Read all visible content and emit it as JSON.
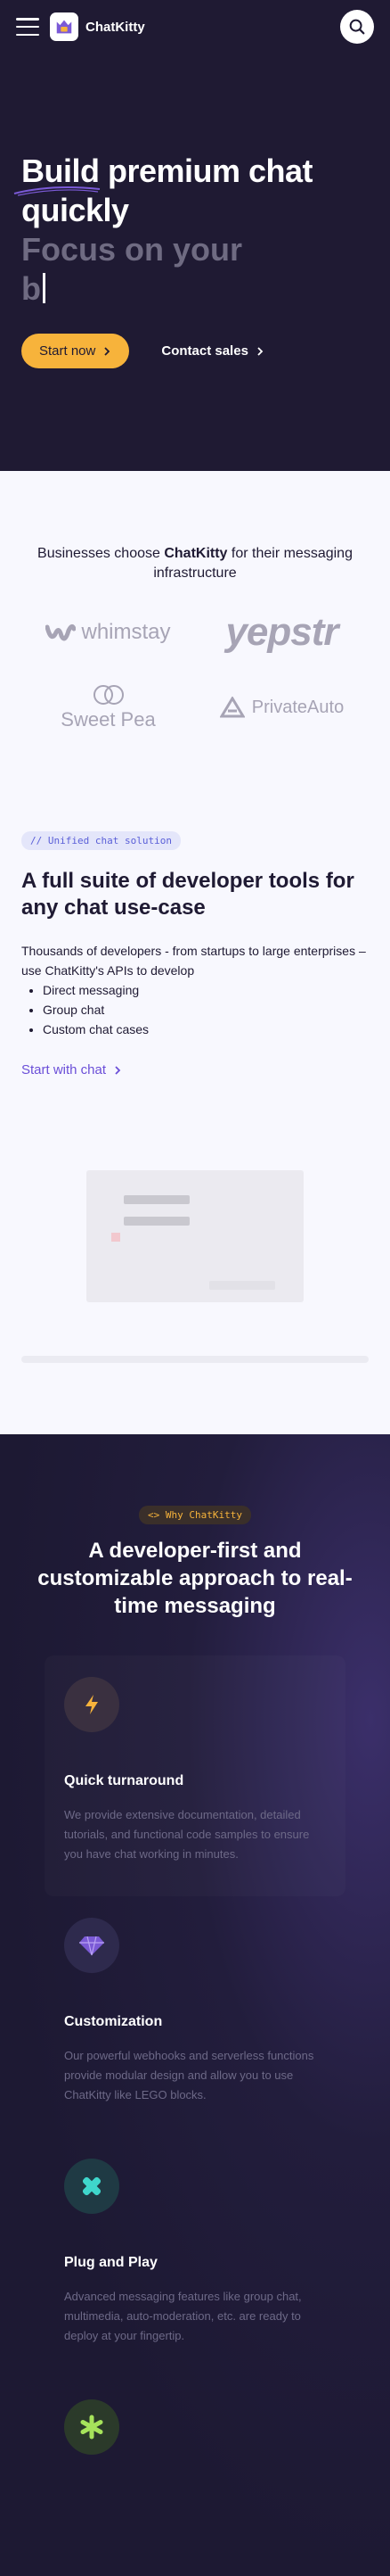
{
  "header": {
    "brand": "ChatKitty"
  },
  "hero": {
    "title": "Build premium chat quickly",
    "typed_line": "Focus on your",
    "typed_partial": "b",
    "start_label": "Start now",
    "contact_label": "Contact sales"
  },
  "customers": {
    "prefix": "Businesses choose ",
    "brand": "ChatKitty",
    "suffix": " for their messaging infrastructure",
    "logos": [
      "whimstay",
      "yepstr",
      "Sweet Pea",
      "PrivateAuto"
    ]
  },
  "suite": {
    "tag": "// Unified chat solution",
    "title": "A full suite of developer tools for any chat use-case",
    "description": "Thousands of developers - from startups to large enterprises – use ChatKitty's APIs to develop",
    "items": [
      "Direct messaging",
      "Group chat",
      "Custom chat cases"
    ],
    "link": "Start with chat"
  },
  "why": {
    "tag": "<> Why ChatKitty",
    "title": "A developer-first and customizable approach to real-time messaging",
    "features": [
      {
        "title": "Quick turnaround",
        "text": "We provide extensive documentation, detailed tutorials, and functional code samples to ensure you have chat working in minutes.",
        "icon": "lightning-icon"
      },
      {
        "title": "Customization",
        "text": "Our powerful webhooks and serverless functions provide modular design and allow you to use ChatKitty like LEGO blocks.",
        "icon": "diamond-icon"
      },
      {
        "title": "Plug and Play",
        "text": "Advanced messaging features like group chat, multimedia, auto-moderation, etc. are ready to deploy at your fingertip.",
        "icon": "puzzle-icon"
      }
    ]
  },
  "colors": {
    "dark": "#1f1a33",
    "accent": "#f7b33b",
    "purple": "#6b4fd8"
  }
}
